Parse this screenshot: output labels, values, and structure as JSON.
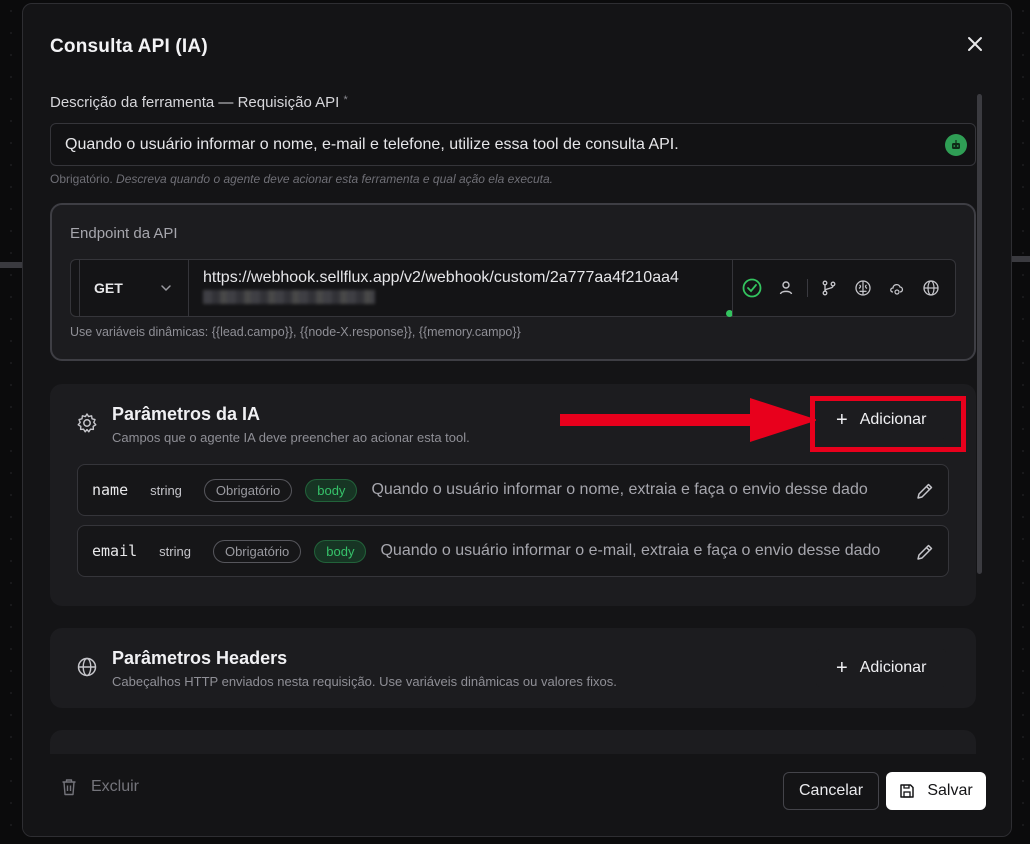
{
  "modal": {
    "title": "Consulta API (IA)"
  },
  "description": {
    "label": "Descrição da ferramenta — Requisição API",
    "required_mark": "*",
    "value": "Quando o usuário informar o nome, e-mail e telefone, utilize essa tool de consulta API.",
    "helper_prefix": "Obrigatório.",
    "helper_text": "Descreva quando o agente deve acionar esta ferramenta e qual ação ela executa."
  },
  "endpoint": {
    "title": "Endpoint da API",
    "method": "GET",
    "url": "https://webhook.sellflux.app/v2/webhook/custom/2a777aa4f210aa4",
    "hint": "Use variáveis dinâmicas: {{lead.campo}}, {{node-X.response}}, {{memory.campo}}",
    "icons": [
      "check-circle-icon",
      "user-icon",
      "branch-icon",
      "brain-icon",
      "cloud-icon",
      "globe-icon"
    ],
    "status_color": "#33c45f"
  },
  "ia_params": {
    "title": "Parâmetros da IA",
    "subtitle": "Campos que o agente IA deve preencher ao acionar esta tool.",
    "add_label": "Adicionar",
    "rows": [
      {
        "name": "name",
        "type": "string",
        "required": "Obrigatório",
        "location": "body",
        "description": "Quando o usuário informar o nome, extraia e faça o envio desse dado"
      },
      {
        "name": "email",
        "type": "string",
        "required": "Obrigatório",
        "location": "body",
        "description": "Quando o usuário informar o e-mail, extraia e faça o envio desse dado"
      }
    ]
  },
  "headers_params": {
    "title": "Parâmetros Headers",
    "subtitle": "Cabeçalhos HTTP enviados nesta requisição. Use variáveis dinâmicas ou valores fixos.",
    "add_label": "Adicionar"
  },
  "footer": {
    "delete_label": "Excluir",
    "cancel_label": "Cancelar",
    "save_label": "Salvar"
  },
  "colors": {
    "highlight": "#e8001c",
    "accent_green": "#2f9e55"
  }
}
